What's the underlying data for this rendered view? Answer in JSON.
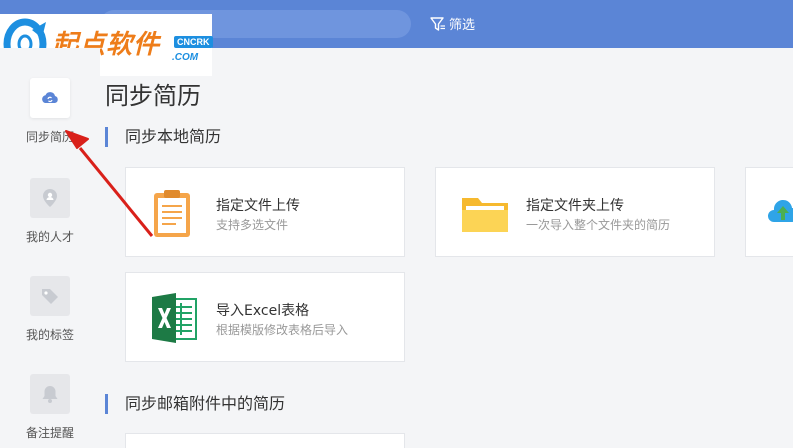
{
  "topbar": {
    "filter_label": "筛选"
  },
  "watermark": {
    "brand": "起点软件",
    "tag": "CNCRK",
    "com": ".COM"
  },
  "sidebar": {
    "items": [
      {
        "label": "同步简历",
        "icon": "cloud-sync-icon",
        "active": true
      },
      {
        "label": "我的人才",
        "icon": "location-person-icon"
      },
      {
        "label": "我的标签",
        "icon": "tag-icon"
      },
      {
        "label": "备注提醒",
        "icon": "bell-icon"
      }
    ]
  },
  "main": {
    "title": "同步简历",
    "sections": [
      {
        "title": "同步本地简历"
      },
      {
        "title": "同步邮箱附件中的简历"
      }
    ],
    "cards": [
      {
        "title": "指定文件上传",
        "subtitle": "支持多选文件",
        "icon": "clipboard-icon"
      },
      {
        "title": "指定文件夹上传",
        "subtitle": "一次导入整个文件夹的简历",
        "icon": "folder-icon"
      },
      {
        "title": "导入Excel表格",
        "subtitle": "根据模版修改表格后导入",
        "icon": "excel-icon"
      }
    ]
  },
  "colors": {
    "accent": "#5b85d6",
    "arrow": "#d9201a",
    "brand_orange": "#ee7d1a",
    "brand_blue": "#1d8fe0"
  }
}
